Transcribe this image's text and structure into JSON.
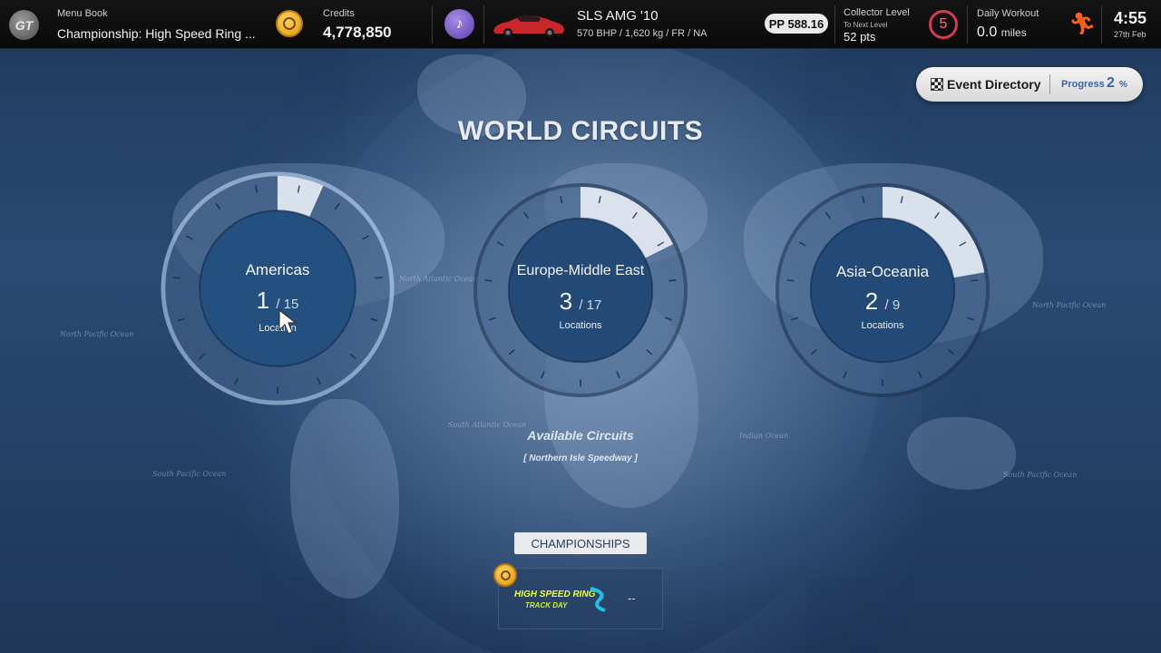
{
  "topbar": {
    "menu_book_label": "Menu Book",
    "menu_book_value": "Championship: High Speed Ring ...",
    "credits_label": "Credits",
    "credits_value": "4,778,850",
    "car_name": "SLS AMG '10",
    "car_specs": "570 BHP / 1,620 kg / FR / NA",
    "pp_value": "PP 588.16",
    "collector_label": "Collector Level",
    "collector_next": "To Next Level",
    "collector_pts": "52 pts",
    "collector_level": "5",
    "workout_label": "Daily Workout",
    "workout_value": "0.0",
    "workout_unit": "miles",
    "time": "4:55",
    "date": "27th Feb",
    "logo_text": "GT"
  },
  "title": "WORLD CIRCUITS",
  "event_directory": {
    "label": "Event Directory",
    "progress_label": "Progress",
    "progress_value": "2",
    "progress_unit": "%"
  },
  "regions": [
    {
      "name": "Americas",
      "count": "1",
      "total": "/ 15",
      "sub": "Location",
      "fraction": 0.0667
    },
    {
      "name": "Europe-Middle East",
      "count": "3",
      "total": "/ 17",
      "sub": "Locations",
      "fraction": 0.1765
    },
    {
      "name": "Asia-Oceania",
      "count": "2",
      "total": "/ 9",
      "sub": "Locations",
      "fraction": 0.2222
    }
  ],
  "circuits": {
    "title": "Available Circuits",
    "item": "[ Northern Isle Speedway ]"
  },
  "championships": {
    "label": "CHAMPIONSHIPS",
    "logo_line1": "HIGH SPEED RING",
    "logo_line2": "TRACK DAY",
    "result": "--"
  },
  "ocean_labels": [
    "North Pacific Ocean",
    "North Atlantic Ocean",
    "South Atlantic Ocean",
    "South Pacific Ocean",
    "Indian Ocean",
    "North Pacific Ocean",
    "South Pacific Ocean"
  ],
  "colors": {
    "accent_level": "#d53a54",
    "workout_runner": "#ff6020",
    "progress_blue": "#3a64a8",
    "coin_gold": "#f0b429"
  }
}
